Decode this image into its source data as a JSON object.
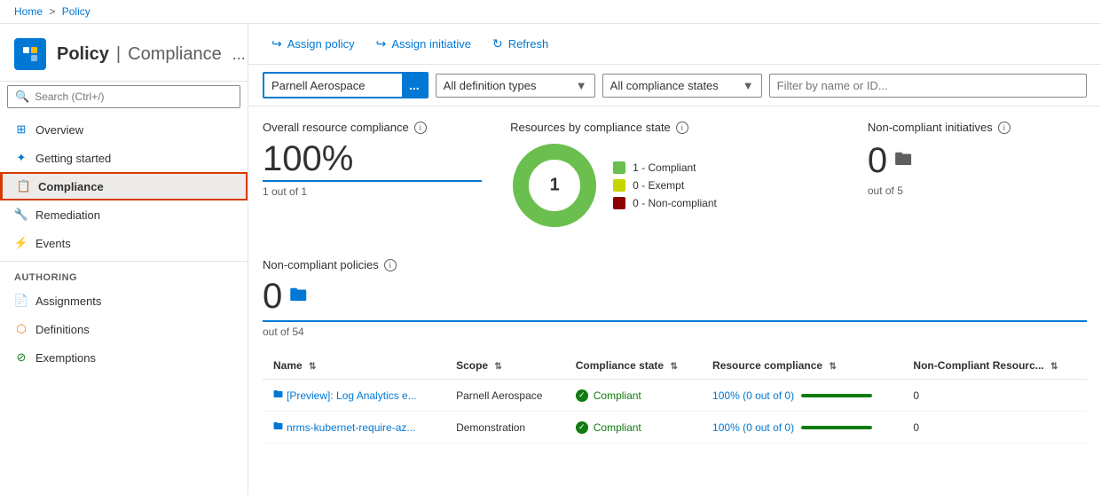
{
  "breadcrumb": {
    "home": "Home",
    "separator": ">",
    "current": "Policy"
  },
  "header": {
    "title": "Policy",
    "subtitle": "Compliance",
    "more": "..."
  },
  "sidebar": {
    "search_placeholder": "Search (Ctrl+/)",
    "nav_items": [
      {
        "id": "overview",
        "label": "Overview",
        "icon": "grid"
      },
      {
        "id": "getting-started",
        "label": "Getting started",
        "icon": "star"
      },
      {
        "id": "compliance",
        "label": "Compliance",
        "icon": "policy",
        "active": true
      }
    ],
    "authoring_section": "Authoring",
    "authoring_items": [
      {
        "id": "assignments",
        "label": "Assignments",
        "icon": "assignment"
      },
      {
        "id": "definitions",
        "label": "Definitions",
        "icon": "definition"
      },
      {
        "id": "exemptions",
        "label": "Exemptions",
        "icon": "exemption"
      }
    ],
    "remediation_label": "Remediation",
    "events_label": "Events"
  },
  "toolbar": {
    "assign_policy": "Assign policy",
    "assign_initiative": "Assign initiative",
    "refresh": "Refresh"
  },
  "filters": {
    "scope_value": "Parnell Aerospace",
    "scope_btn": "...",
    "definition_types_label": "All definition types",
    "compliance_states_label": "All compliance states",
    "filter_placeholder": "Filter by name or ID..."
  },
  "stats": {
    "overall_label": "Overall resource compliance",
    "overall_value": "100%",
    "overall_sub": "1 out of 1",
    "chart_center": "1",
    "chart_data": [
      {
        "label": "1 - Compliant",
        "value": 1,
        "color": "#6bbf4e",
        "pct": 100
      },
      {
        "label": "0 - Exempt",
        "value": 0,
        "color": "#c8d400",
        "pct": 0
      },
      {
        "label": "0 - Non-compliant",
        "value": 0,
        "color": "#8b0000",
        "pct": 0
      }
    ],
    "resources_by_state_label": "Resources by compliance state",
    "non_compliant_initiatives_label": "Non-compliant initiatives",
    "initiatives_value": "0",
    "initiatives_sub": "out of 5",
    "non_compliant_policies_label": "Non-compliant policies",
    "policies_value": "0",
    "policies_sub": "out of 54"
  },
  "table": {
    "columns": [
      {
        "id": "name",
        "label": "Name"
      },
      {
        "id": "scope",
        "label": "Scope"
      },
      {
        "id": "compliance_state",
        "label": "Compliance state"
      },
      {
        "id": "resource_compliance",
        "label": "Resource compliance"
      },
      {
        "id": "non_compliant",
        "label": "Non-Compliant Resourc..."
      }
    ],
    "rows": [
      {
        "name": "[Preview]: Log Analytics e...",
        "scope": "Parnell Aerospace",
        "compliance_state": "Compliant",
        "resource_compliance": "100% (0 out of 0)",
        "non_compliant": "0",
        "bar_pct": 100
      },
      {
        "name": "nrms-kubernet-require-az...",
        "scope": "Demonstration",
        "compliance_state": "Compliant",
        "resource_compliance": "100% (0 out of 0)",
        "non_compliant": "0",
        "bar_pct": 100
      }
    ]
  }
}
